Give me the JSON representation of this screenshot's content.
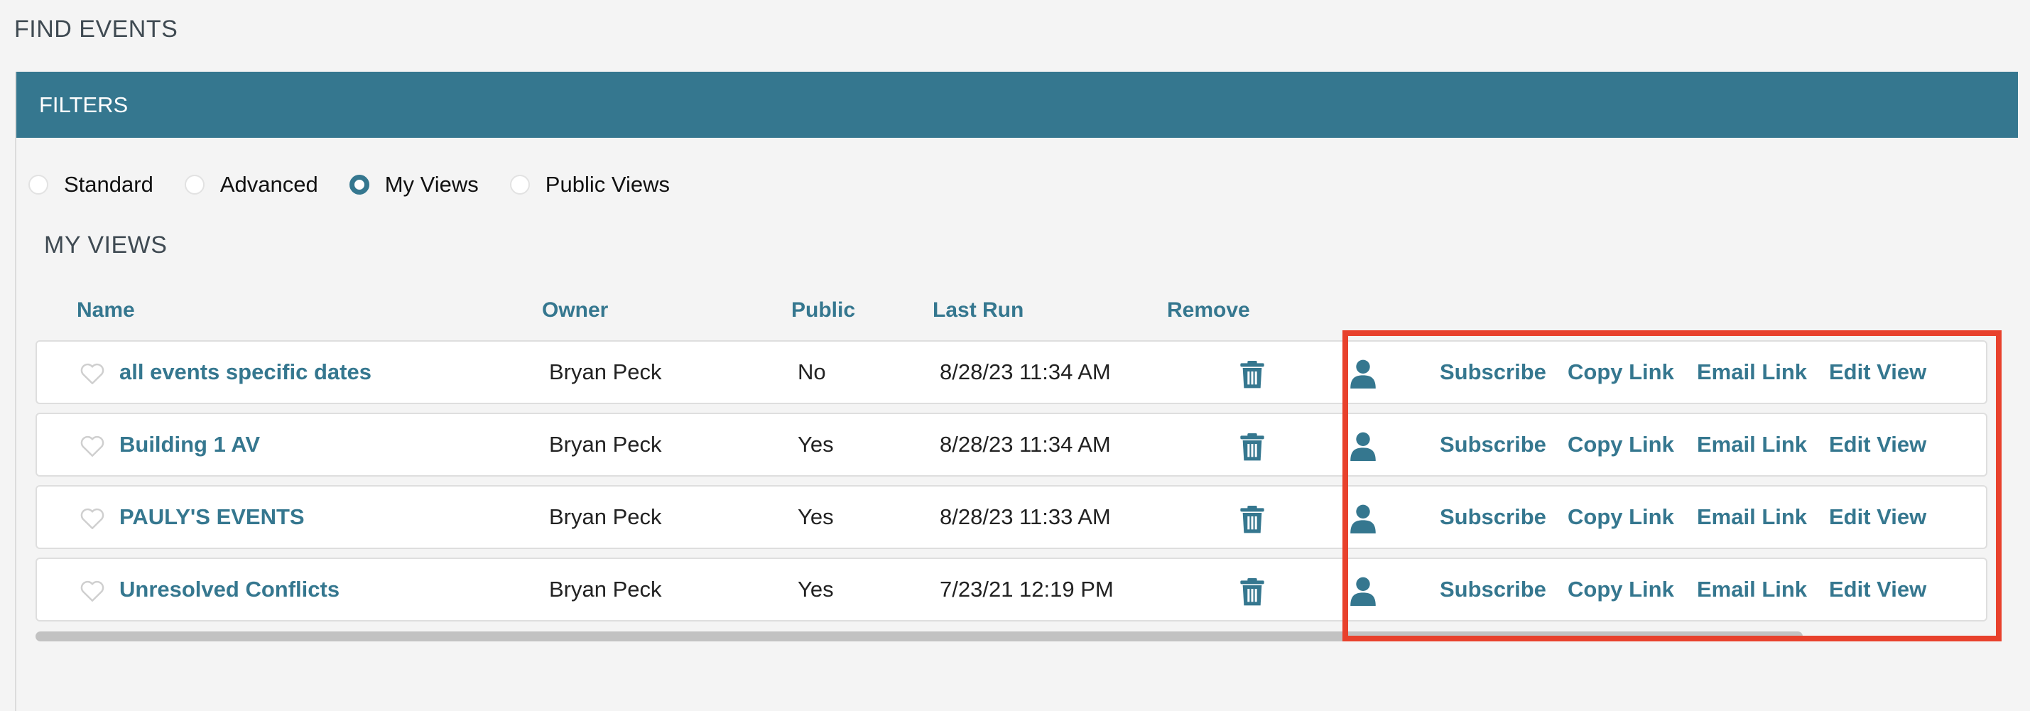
{
  "page": {
    "title": "FIND EVENTS"
  },
  "filters": {
    "header": "FILTERS",
    "options": [
      {
        "label": "Standard",
        "checked": false
      },
      {
        "label": "Advanced",
        "checked": false
      },
      {
        "label": "My Views",
        "checked": true
      },
      {
        "label": "Public Views",
        "checked": false
      }
    ]
  },
  "my_views": {
    "title": "MY VIEWS",
    "columns": {
      "name": "Name",
      "owner": "Owner",
      "public": "Public",
      "last_run": "Last Run",
      "remove": "Remove"
    },
    "rows": [
      {
        "name": "all events specific dates",
        "owner": "Bryan Peck",
        "public": "No",
        "last_run": "8/28/23 11:34 AM"
      },
      {
        "name": "Building 1 AV",
        "owner": "Bryan Peck",
        "public": "Yes",
        "last_run": "8/28/23 11:34 AM"
      },
      {
        "name": "PAULY'S EVENTS",
        "owner": "Bryan Peck",
        "public": "Yes",
        "last_run": "8/28/23 11:33 AM"
      },
      {
        "name": "Unresolved Conflicts",
        "owner": "Bryan Peck",
        "public": "Yes",
        "last_run": "7/23/21 12:19 PM"
      }
    ],
    "actions": {
      "subscribe": "Subscribe",
      "copy_link": "Copy Link",
      "email_link": "Email Link",
      "edit_view": "Edit View"
    },
    "icons": {
      "favorite": "heart-outline-icon",
      "remove": "trash-icon",
      "owner": "person-icon"
    }
  },
  "colors": {
    "accent": "#35778f",
    "highlight": "#e8412c"
  }
}
